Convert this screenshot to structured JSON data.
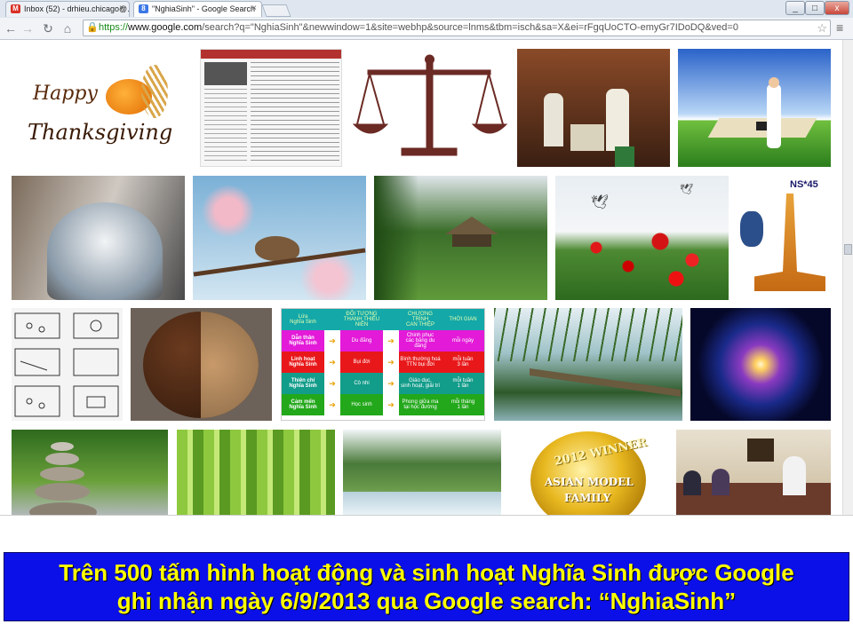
{
  "tabs": [
    {
      "label": "Inbox (52) - drhieu.chicago@...",
      "icon": "gmail-icon"
    },
    {
      "label": "\"NghiaSinh\" - Google Search",
      "icon": "google-icon"
    }
  ],
  "window": {
    "minimize": "_",
    "restore": "□",
    "close": "x"
  },
  "toolbar": {
    "url_scheme": "https://",
    "url_host": "www.google.com",
    "url_rest": "/search?q=\"NghiaSinh\"&newwindow=1&site=webhp&source=lnms&tbm=isch&sa=X&ei=rFgqUoCTO-emyGr7IDoDQ&ved=0"
  },
  "thumbs": {
    "thanksgiving_1": "Happy",
    "thanksgiving_2": "Thanksgiving",
    "winner_1": "2012 WINNER",
    "winner_2": "ASIAN MODEL",
    "winner_3": "FAMILY",
    "ns45": "NS*45"
  },
  "program_table": {
    "headers": [
      "Lứa\nNghĩa Sinh",
      "ĐỐI TƯỢNG\nTHANH THIẾU NIÊN",
      "CHƯƠNG TRÌNH\nCAN THIỆP",
      "THỜI GIAN"
    ],
    "rows": [
      [
        "Dẫn thân\nNghĩa Sinh",
        "Du đãng",
        "Chinh phục\ncác băng du đãng",
        "mỗi ngày"
      ],
      [
        "Linh hoạt\nNghĩa Sinh",
        "Bụi đời",
        "Bình thường hoá\nTTN bụi đời",
        "mỗi tuần\n3 lần"
      ],
      [
        "Thiên chí\nNghĩa Sinh",
        "Cô nhi",
        "Giáo dục,\nsinh hoạt, giải trí",
        "mỗi tuần\n1 lần"
      ],
      [
        "Cảm mến\nNghĩa Sinh",
        "Học sinh",
        "Phong giữa ma\ntại học đường",
        "mỗi tháng\n1 lần"
      ]
    ]
  },
  "caption": {
    "line1": "Trên 500 tấm hình hoạt động và sinh hoạt Nghĩa Sinh được Google",
    "line2": "ghi nhận ngày 6/9/2013 qua Google search: “NghiaSinh”"
  },
  "colors": {
    "banner_bg": "#0b10e8",
    "banner_text": "#ffff00"
  }
}
